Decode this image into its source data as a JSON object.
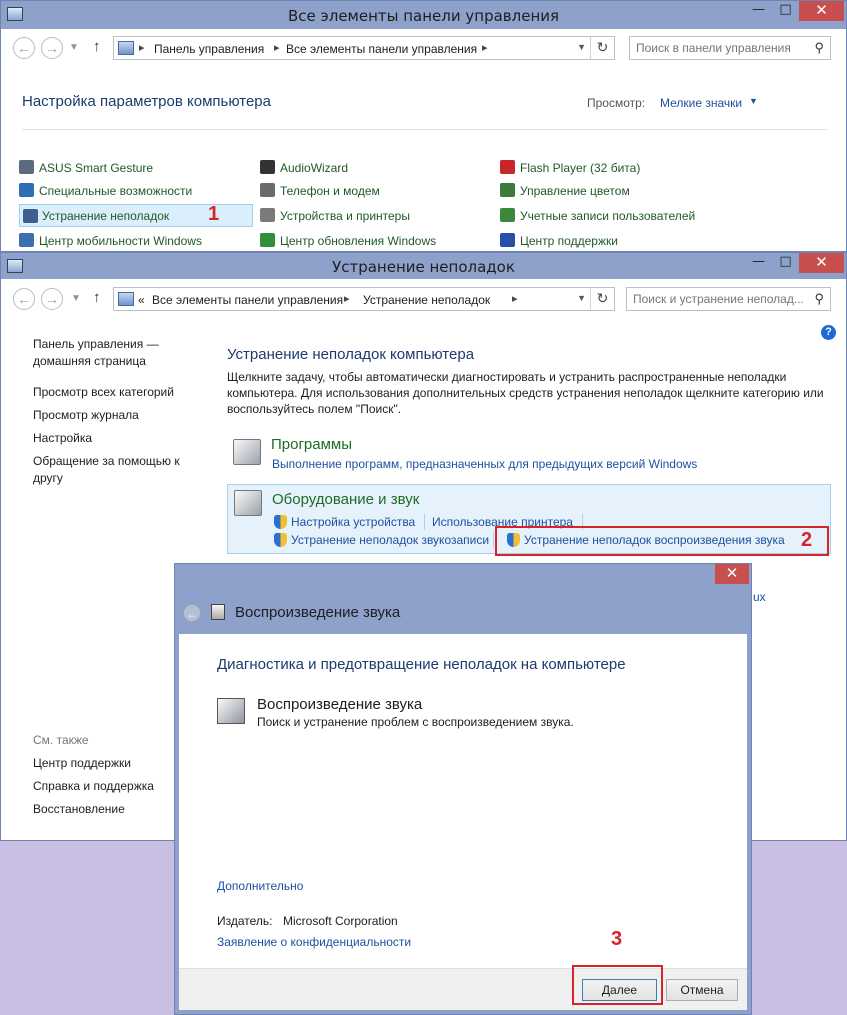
{
  "win1": {
    "title": "Все элементы панели управления",
    "breadcrumb": [
      "Панель управления",
      "Все элементы панели управления"
    ],
    "search_placeholder": "Поиск в панели управления",
    "header": "Настройка параметров компьютера",
    "view_label": "Просмотр:",
    "view_value": "Мелкие значки",
    "items": [
      {
        "label": "ASUS Smart Gesture",
        "icon": "touchpad-icon",
        "color": "#5d6b7c"
      },
      {
        "label": "AudioWizard",
        "icon": "audio-wizard-icon",
        "color": "#333333"
      },
      {
        "label": "Flash Player (32 бита)",
        "icon": "flash-icon",
        "color": "#c8262a"
      },
      {
        "label": "Специальные возможности",
        "icon": "accessibility-icon",
        "color": "#2d6fb5"
      },
      {
        "label": "Телефон и модем",
        "icon": "phone-icon",
        "color": "#6b6b6b"
      },
      {
        "label": "Управление цветом",
        "icon": "color-management-icon",
        "color": "#3a7a3a"
      },
      {
        "label": "Устранение неполадок",
        "icon": "troubleshoot-icon",
        "color": "#3c5f8f"
      },
      {
        "label": "Устройства и принтеры",
        "icon": "printer-icon",
        "color": "#7a7a7a"
      },
      {
        "label": "Учетные записи пользователей",
        "icon": "users-icon",
        "color": "#3a8a3a"
      },
      {
        "label": "Центр мобильности Windows",
        "icon": "mobility-icon",
        "color": "#3c6fb0"
      },
      {
        "label": "Центр обновления Windows",
        "icon": "windows-update-icon",
        "color": "#2f8f3a"
      },
      {
        "label": "Центр поддержки",
        "icon": "flag-icon",
        "color": "#2a4fa8"
      }
    ],
    "step_label": "1"
  },
  "win2": {
    "title": "Устранение неполадок",
    "breadcrumb_prefix": "«",
    "breadcrumb": [
      "Все элементы панели управления",
      "Устранение неполадок"
    ],
    "search_placeholder": "Поиск и устранение неполад...",
    "sidebar": {
      "home_line1": "Панель управления —",
      "home_line2": "домашняя страница",
      "links": [
        "Просмотр всех категорий",
        "Просмотр журнала",
        "Настройка"
      ],
      "help_line1": "Обращение за помощью к",
      "help_line2": "другу",
      "see_also": "См. также",
      "see_also_links": [
        "Центр поддержки",
        "Справка и поддержка",
        "Восстановление"
      ]
    },
    "heading": "Устранение неполадок компьютера",
    "description": "Щелкните задачу, чтобы автоматически диагностировать и устранить распространенные неполадки компьютера. Для использования дополнительных средств устранения неполадок щелкните категорию или воспользуйтесь полем \"Поиск\".",
    "programs": {
      "title": "Программы",
      "link": "Выполнение программ, предназначенных для предыдущих версий Windows"
    },
    "hardware": {
      "title": "Оборудование и звук",
      "links": [
        "Настройка устройства",
        "Использование принтера",
        "Устранение неполадок звукозаписи",
        "Устранение неполадок воспроизведения звука"
      ]
    },
    "hidden_fragment": "ux",
    "step_label": "2"
  },
  "dialog": {
    "title": "Воспроизведение звука",
    "heading": "Диагностика и предотвращение неполадок на компьютере",
    "tool_name": "Воспроизведение звука",
    "tool_desc": "Поиск и устранение проблем с воспроизведением звука.",
    "advanced": "Дополнительно",
    "publisher_label": "Издатель:",
    "publisher": "Microsoft Corporation",
    "privacy": "Заявление о конфиденциальности",
    "next": "Далее",
    "cancel": "Отмена",
    "step_label": "3"
  },
  "controls": {
    "minimize": "—",
    "maximize": "□",
    "close": "✕",
    "back": "←",
    "forward": "→",
    "up": "↑",
    "refresh": "↻",
    "search_icon": "search-icon"
  },
  "colors": {
    "titlebar": "#8da1cb",
    "accent_red": "#d8232a",
    "link": "#1e50a0",
    "green_title": "#1e6b28"
  }
}
